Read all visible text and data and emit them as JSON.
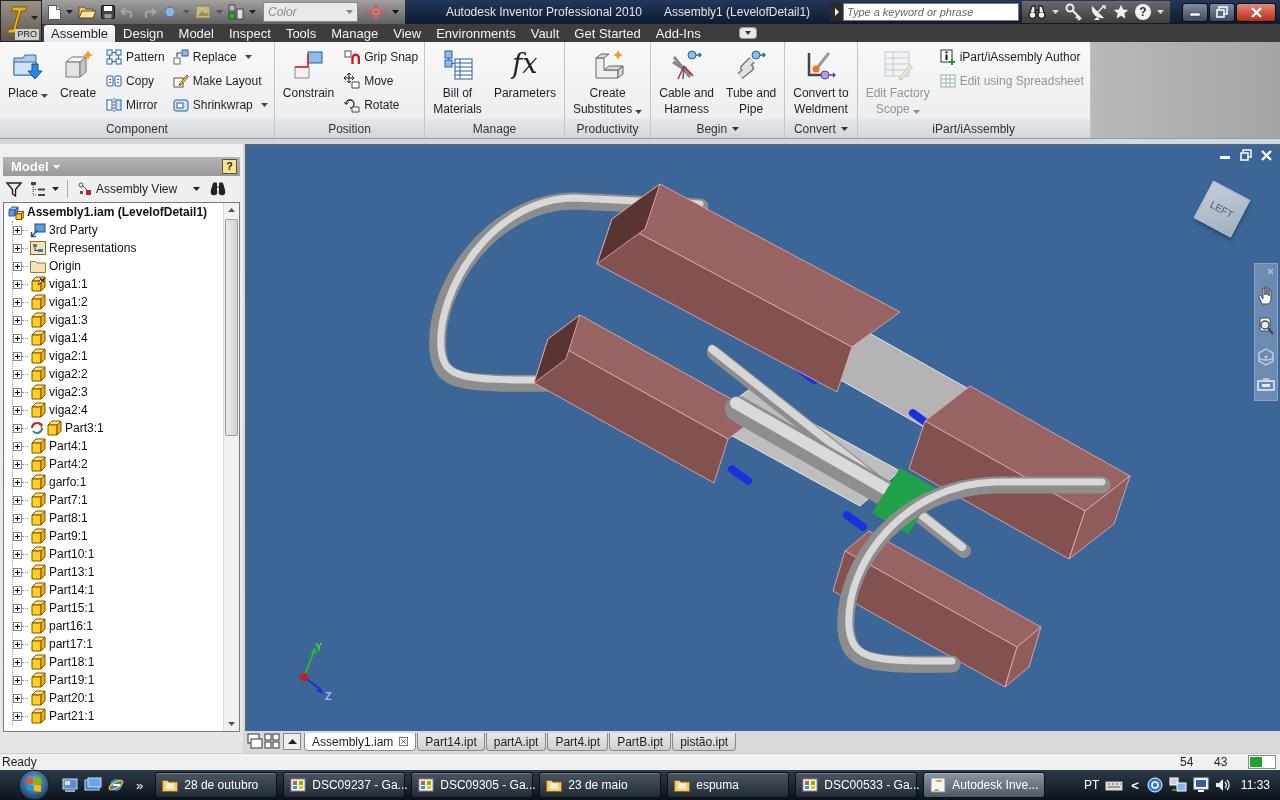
{
  "title_bar": {
    "app_badge": "PRO",
    "style_dropdown": {
      "value": "Color",
      "disabled": true
    },
    "title": "Autodesk Inventor Professional 2010",
    "document": "Assembly1 (LevelofDetail1)",
    "search": {
      "placeholder": "Type a keyword or phrase"
    },
    "help": "?"
  },
  "ribbon_tabs": [
    {
      "label": "Assemble",
      "selected": true
    },
    {
      "label": "Design",
      "selected": false
    },
    {
      "label": "Model",
      "selected": false
    },
    {
      "label": "Inspect",
      "selected": false
    },
    {
      "label": "Tools",
      "selected": false
    },
    {
      "label": "Manage",
      "selected": false
    },
    {
      "label": "View",
      "selected": false
    },
    {
      "label": "Environments",
      "selected": false
    },
    {
      "label": "Vault",
      "selected": false
    },
    {
      "label": "Get Started",
      "selected": false
    },
    {
      "label": "Add-Ins",
      "selected": false
    }
  ],
  "ribbon_panels": [
    {
      "title": "Component",
      "menu": false,
      "tools": [
        {
          "kind": "large",
          "label": "Place",
          "dropdown": true,
          "disabled": false
        },
        {
          "kind": "large",
          "label": "Create",
          "dropdown": false,
          "disabled": false
        },
        {
          "kind": "small",
          "label": "Pattern",
          "dropdown": false,
          "disabled": false
        },
        {
          "kind": "small",
          "label": "Copy",
          "dropdown": false,
          "disabled": false
        },
        {
          "kind": "small",
          "label": "Mirror",
          "dropdown": false,
          "disabled": false
        },
        {
          "kind": "small",
          "label": "Replace",
          "dropdown": true,
          "disabled": false
        },
        {
          "kind": "small",
          "label": "Make Layout",
          "dropdown": false,
          "disabled": false
        },
        {
          "kind": "small",
          "label": "Shrinkwrap",
          "dropdown": true,
          "disabled": false
        }
      ]
    },
    {
      "title": "Position",
      "menu": false,
      "tools": [
        {
          "kind": "large",
          "label": "Constrain",
          "dropdown": false,
          "disabled": false
        },
        {
          "kind": "small",
          "label": "Grip Snap",
          "dropdown": false,
          "disabled": false
        },
        {
          "kind": "small",
          "label": "Move",
          "dropdown": false,
          "disabled": false
        },
        {
          "kind": "small",
          "label": "Rotate",
          "dropdown": false,
          "disabled": false
        }
      ]
    },
    {
      "title": "Manage",
      "menu": false,
      "tools": [
        {
          "kind": "large",
          "label": "Bill of\nMaterials",
          "dropdown": false,
          "disabled": false
        },
        {
          "kind": "large",
          "label": "Parameters",
          "glyph": "fx",
          "dropdown": false,
          "disabled": false
        }
      ]
    },
    {
      "title": "Productivity",
      "menu": false,
      "tools": [
        {
          "kind": "large",
          "label": "Create\nSubstitutes",
          "dropdown": true,
          "disabled": false
        }
      ]
    },
    {
      "title": "Begin",
      "menu": true,
      "tools": [
        {
          "kind": "large",
          "label": "Cable and\nHarness",
          "dropdown": false,
          "disabled": false
        },
        {
          "kind": "large",
          "label": "Tube and\nPipe",
          "dropdown": false,
          "disabled": false
        }
      ]
    },
    {
      "title": "Convert",
      "menu": true,
      "tools": [
        {
          "kind": "large",
          "label": "Convert to\nWeldment",
          "dropdown": false,
          "disabled": false
        }
      ]
    },
    {
      "title": "iPart/iAssembly",
      "menu": false,
      "tools": [
        {
          "kind": "large",
          "label": "Edit Factory\nScope",
          "dropdown": true,
          "disabled": true
        },
        {
          "kind": "small",
          "label": "iPart/iAssembly Author",
          "dropdown": false,
          "disabled": false
        },
        {
          "kind": "small",
          "label": "Edit using Spreadsheet",
          "dropdown": false,
          "disabled": true
        }
      ]
    }
  ],
  "browser": {
    "title": "Model",
    "help": "?",
    "view": "Assembly View",
    "tree": {
      "label": "Assembly1.iam (LevelofDetail1)",
      "kind": "assembly",
      "children": [
        {
          "label": "3rd Party",
          "kind": "third-party",
          "expanded": false
        },
        {
          "label": "Representations",
          "kind": "representations",
          "expanded": false
        },
        {
          "label": "Origin",
          "kind": "folder",
          "expanded": false
        },
        {
          "label": "viga1:1",
          "kind": "grounded-part",
          "expanded": false
        },
        {
          "label": "viga1:2",
          "kind": "part",
          "expanded": false
        },
        {
          "label": "viga1:3",
          "kind": "part",
          "expanded": false
        },
        {
          "label": "viga1:4",
          "kind": "part",
          "expanded": false
        },
        {
          "label": "viga2:1",
          "kind": "part",
          "expanded": false
        },
        {
          "label": "viga2:2",
          "kind": "part",
          "expanded": false
        },
        {
          "label": "viga2:3",
          "kind": "part",
          "expanded": false
        },
        {
          "label": "viga2:4",
          "kind": "part",
          "expanded": false
        },
        {
          "label": "Part3:1",
          "kind": "refresh-part",
          "expanded": false
        },
        {
          "label": "Part4:1",
          "kind": "part",
          "expanded": false
        },
        {
          "label": "Part4:2",
          "kind": "part",
          "expanded": false
        },
        {
          "label": "garfo:1",
          "kind": "part",
          "expanded": false
        },
        {
          "label": "Part7:1",
          "kind": "part",
          "expanded": false
        },
        {
          "label": "Part8:1",
          "kind": "part",
          "expanded": false
        },
        {
          "label": "Part9:1",
          "kind": "part",
          "expanded": false
        },
        {
          "label": "Part10:1",
          "kind": "part",
          "expanded": false
        },
        {
          "label": "Part13:1",
          "kind": "part",
          "expanded": false
        },
        {
          "label": "Part14:1",
          "kind": "part",
          "expanded": false
        },
        {
          "label": "Part15:1",
          "kind": "part",
          "expanded": false
        },
        {
          "label": "part16:1",
          "kind": "part",
          "expanded": false
        },
        {
          "label": "part17:1",
          "kind": "part",
          "expanded": false
        },
        {
          "label": "Part18:1",
          "kind": "part",
          "expanded": false
        },
        {
          "label": "Part19:1",
          "kind": "part",
          "expanded": false
        },
        {
          "label": "Part20:1",
          "kind": "part",
          "expanded": false
        },
        {
          "label": "Part21:1",
          "kind": "part",
          "expanded": false
        }
      ]
    }
  },
  "viewport": {
    "view_cube": "LEFT",
    "axes": [
      "Y",
      "Z"
    ]
  },
  "document_tabs": [
    {
      "label": "Assembly1.iam",
      "selected": true
    },
    {
      "label": "Part14.ipt",
      "selected": false
    },
    {
      "label": "partA.ipt",
      "selected": false
    },
    {
      "label": "Part4.ipt",
      "selected": false
    },
    {
      "label": "PartB.ipt",
      "selected": false
    },
    {
      "label": "pistão.ipt",
      "selected": false
    }
  ],
  "status_bar": {
    "message": "Ready",
    "counts": [
      "54",
      "43"
    ]
  },
  "taskbar": {
    "overflow": "»",
    "tasks": [
      {
        "label": "28 de outubro",
        "kind": "folder",
        "selected": false
      },
      {
        "label": "DSC09237 - Ga...",
        "kind": "gallery",
        "selected": false
      },
      {
        "label": "DSC09305 - Ga...",
        "kind": "gallery",
        "selected": false
      },
      {
        "label": "23 de maio",
        "kind": "folder",
        "selected": false
      },
      {
        "label": "espuma",
        "kind": "folder",
        "selected": false
      },
      {
        "label": "DSC00533 - Ga...",
        "kind": "gallery",
        "selected": false
      },
      {
        "label": "Autodesk Inve...",
        "kind": "app",
        "selected": true
      }
    ],
    "tray": {
      "language": "PT",
      "chevron": "<",
      "clock": "11:33"
    }
  }
}
